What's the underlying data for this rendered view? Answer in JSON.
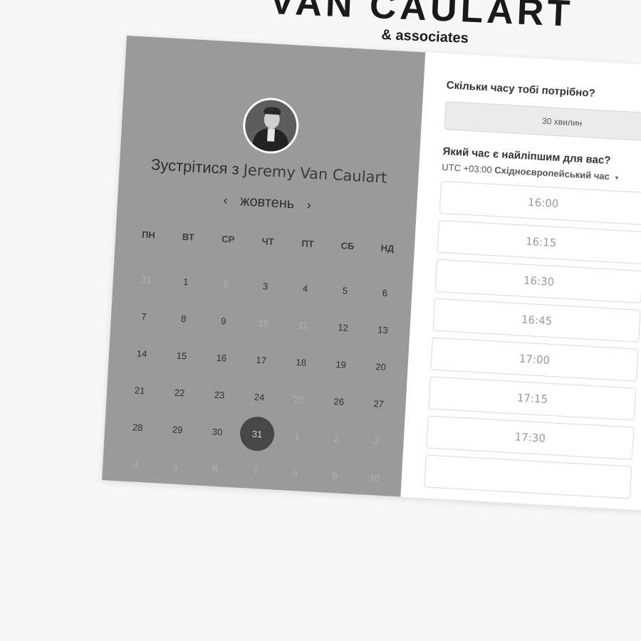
{
  "brand": {
    "title": "VAN CAULART",
    "subtitle": "& associates"
  },
  "host": {
    "meet_prefix": "Зустрітися з",
    "name": "Jeremy Van Caulart"
  },
  "calendar": {
    "prev_icon": "‹",
    "next_icon": "›",
    "month": "жовтень",
    "weekdays": [
      "ПН",
      "ВТ",
      "СР",
      "ЧТ",
      "ПТ",
      "СБ",
      "НД"
    ],
    "days": [
      {
        "label": "31",
        "state": "muted"
      },
      {
        "label": "1",
        "state": "normal"
      },
      {
        "label": "2",
        "state": "muted"
      },
      {
        "label": "3",
        "state": "normal"
      },
      {
        "label": "4",
        "state": "normal"
      },
      {
        "label": "5",
        "state": "normal"
      },
      {
        "label": "6",
        "state": "normal"
      },
      {
        "label": "7",
        "state": "normal"
      },
      {
        "label": "8",
        "state": "normal"
      },
      {
        "label": "9",
        "state": "normal"
      },
      {
        "label": "10",
        "state": "muted"
      },
      {
        "label": "11",
        "state": "muted"
      },
      {
        "label": "12",
        "state": "normal"
      },
      {
        "label": "13",
        "state": "normal"
      },
      {
        "label": "14",
        "state": "normal"
      },
      {
        "label": "15",
        "state": "normal"
      },
      {
        "label": "16",
        "state": "normal"
      },
      {
        "label": "17",
        "state": "normal"
      },
      {
        "label": "18",
        "state": "normal"
      },
      {
        "label": "19",
        "state": "normal"
      },
      {
        "label": "20",
        "state": "normal"
      },
      {
        "label": "21",
        "state": "normal"
      },
      {
        "label": "22",
        "state": "normal"
      },
      {
        "label": "23",
        "state": "normal"
      },
      {
        "label": "24",
        "state": "normal"
      },
      {
        "label": "25",
        "state": "muted"
      },
      {
        "label": "26",
        "state": "normal"
      },
      {
        "label": "27",
        "state": "normal"
      },
      {
        "label": "28",
        "state": "normal"
      },
      {
        "label": "29",
        "state": "normal"
      },
      {
        "label": "30",
        "state": "normal"
      },
      {
        "label": "31",
        "state": "selected"
      },
      {
        "label": "1",
        "state": "muted"
      },
      {
        "label": "2",
        "state": "muted"
      },
      {
        "label": "3",
        "state": "muted"
      },
      {
        "label": "4",
        "state": "muted"
      },
      {
        "label": "5",
        "state": "muted"
      },
      {
        "label": "6",
        "state": "muted"
      },
      {
        "label": "7",
        "state": "muted"
      },
      {
        "label": "8",
        "state": "muted"
      },
      {
        "label": "9",
        "state": "muted"
      },
      {
        "label": "10",
        "state": "muted"
      }
    ]
  },
  "booking": {
    "duration_question": "Скільки часу тобі потрібно?",
    "duration_value": "30 хвилин",
    "time_question": "Який час є найліпшим для вас?",
    "tz_offset": "UTC +03:00",
    "tz_name": "Східноєвропейський час",
    "tz_caret": "▾",
    "slots": [
      "16:00",
      "16:15",
      "16:30",
      "16:45",
      "17:00",
      "17:15",
      "17:30",
      ""
    ]
  },
  "colors": {
    "left_panel": "#9a9a9a",
    "selected_day": "#474747",
    "page_bg": "#f7f7f7"
  }
}
